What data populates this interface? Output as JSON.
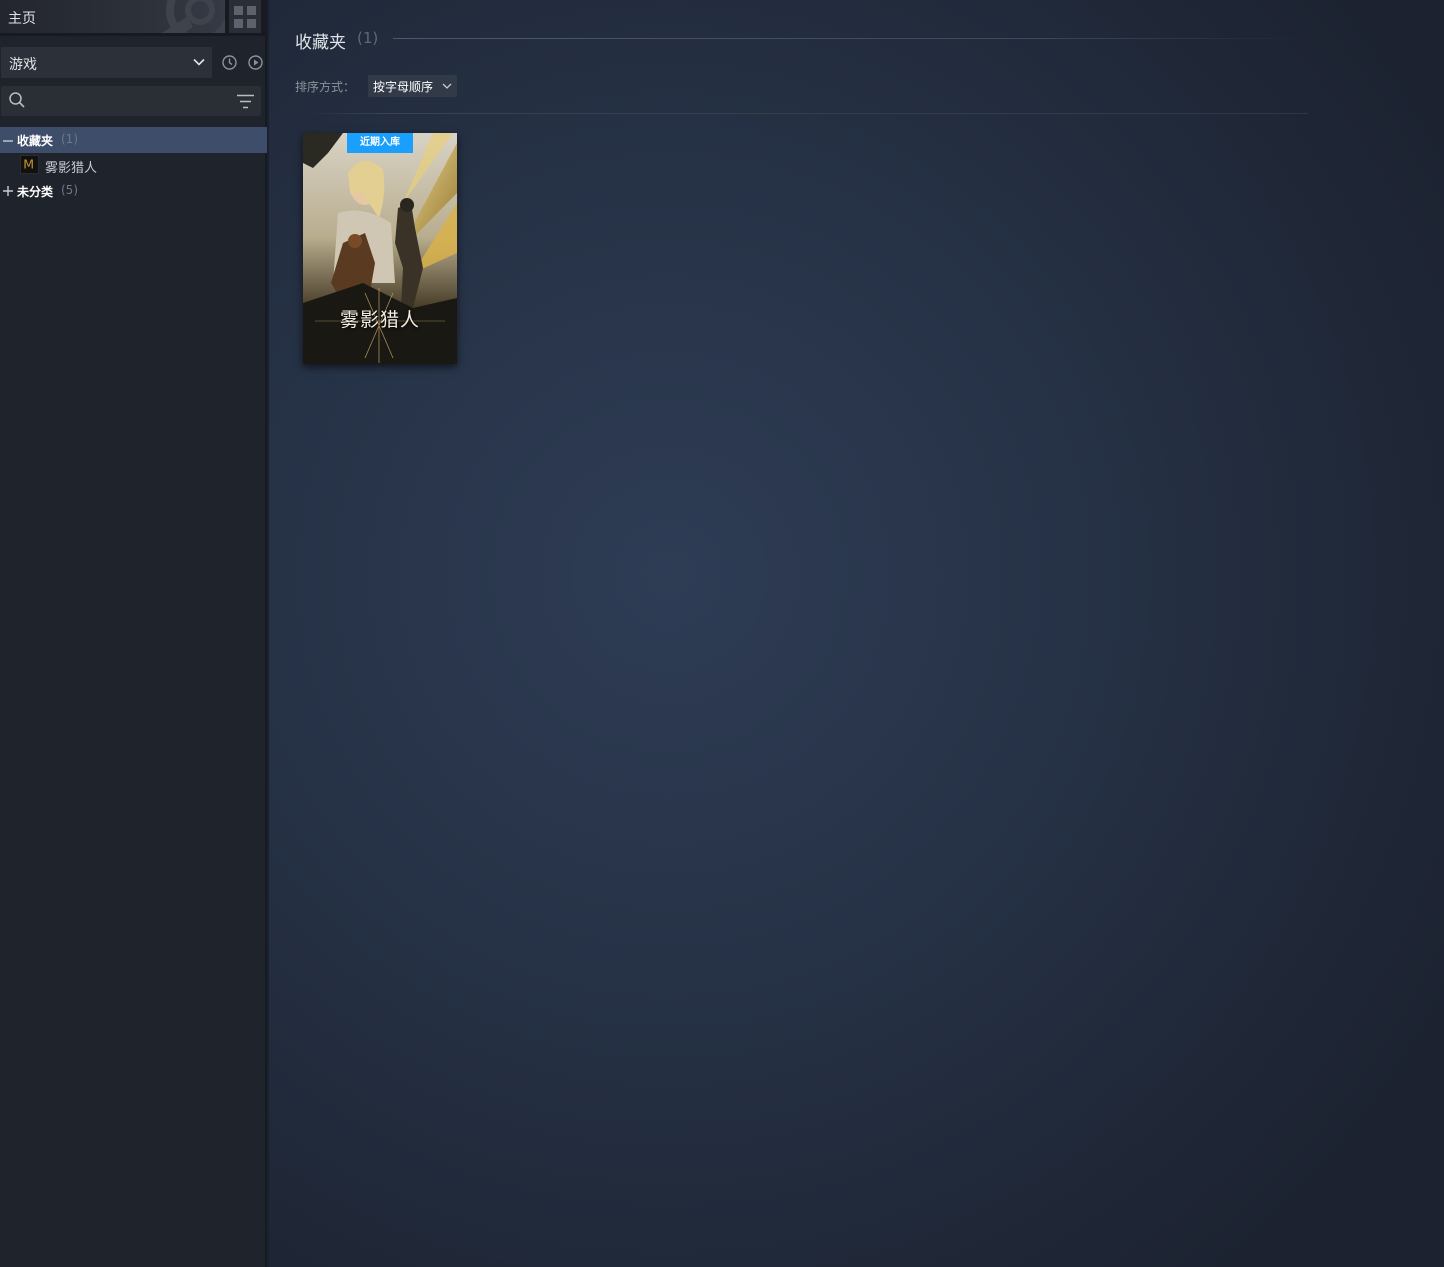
{
  "sidebar": {
    "home_label": "主页",
    "collection_select": "游戏",
    "search": {
      "placeholder": ""
    },
    "tree": {
      "favorites": {
        "label": "收藏夹",
        "count": "(1)",
        "expander": "minus"
      },
      "game": {
        "name": "雾影猎人",
        "icon_letter": "M"
      },
      "uncategorized": {
        "label": "未分类",
        "count": "(5)",
        "expander": "plus"
      }
    }
  },
  "main": {
    "shelf_title": "收藏夹",
    "shelf_count": "(1)",
    "sort_label": "排序方式：",
    "sort_value": "按字母顺序",
    "card": {
      "badge": "近期入库",
      "title": "雾影猎人"
    }
  },
  "colors": {
    "accent": "#1a9fff",
    "selected_row": "#3d4d6a",
    "sidebar_bg": "#1f232b"
  }
}
